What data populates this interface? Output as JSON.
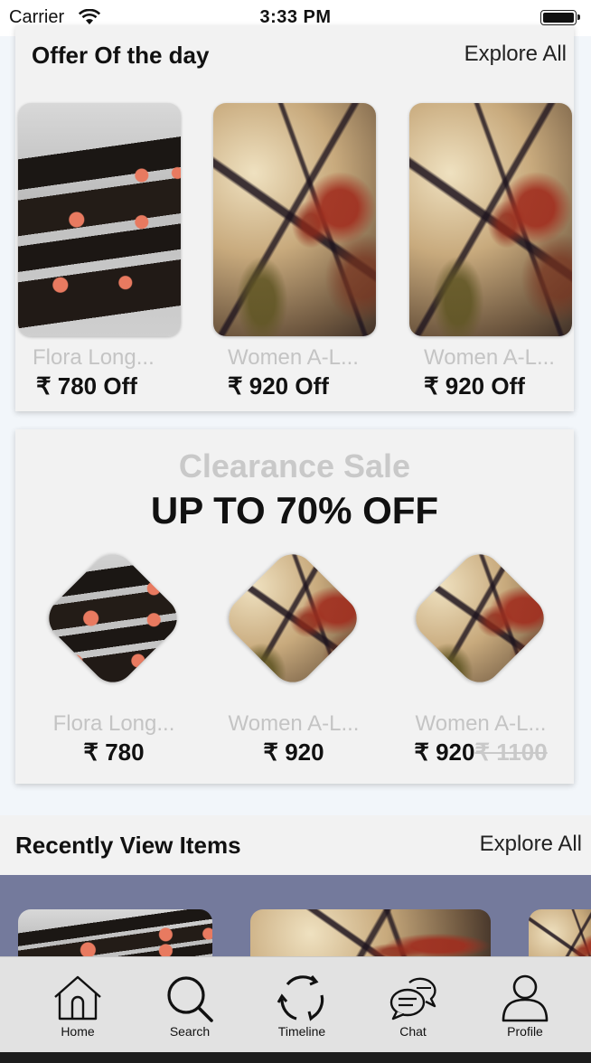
{
  "status_bar": {
    "carrier": "Carrier",
    "time": "3:33 PM"
  },
  "offer_of_day": {
    "title": "Offer Of the day",
    "explore_label": "Explore All",
    "items": [
      {
        "name": "Flora Long...",
        "discount": "₹ 780 Off",
        "image": "bottles"
      },
      {
        "name": "Women A-L...",
        "discount": "₹ 920 Off",
        "image": "leaves"
      },
      {
        "name": "Women A-L...",
        "discount": "₹ 920 Off",
        "image": "leaves"
      }
    ]
  },
  "clearance": {
    "title": "Clearance Sale",
    "subtitle": "UP TO 70% OFF",
    "items": [
      {
        "name": "Flora Long...",
        "price": "₹ 780",
        "original_price": "",
        "image": "bottles"
      },
      {
        "name": "Women A-L...",
        "price": "₹ 920",
        "original_price": "",
        "image": "leaves"
      },
      {
        "name": "Women A-L...",
        "price": "₹ 920",
        "original_price": "₹ 1100",
        "image": "leaves"
      }
    ]
  },
  "recently_viewed": {
    "title": "Recently View Items",
    "explore_label": "Explore All",
    "strip_color": "#747a9c"
  },
  "tab_bar": {
    "tabs": [
      {
        "label": "Home",
        "icon": "home-icon"
      },
      {
        "label": "Search",
        "icon": "search-icon"
      },
      {
        "label": "Timeline",
        "icon": "timeline-icon"
      },
      {
        "label": "Chat",
        "icon": "chat-icon"
      },
      {
        "label": "Profile",
        "icon": "profile-icon"
      }
    ]
  }
}
